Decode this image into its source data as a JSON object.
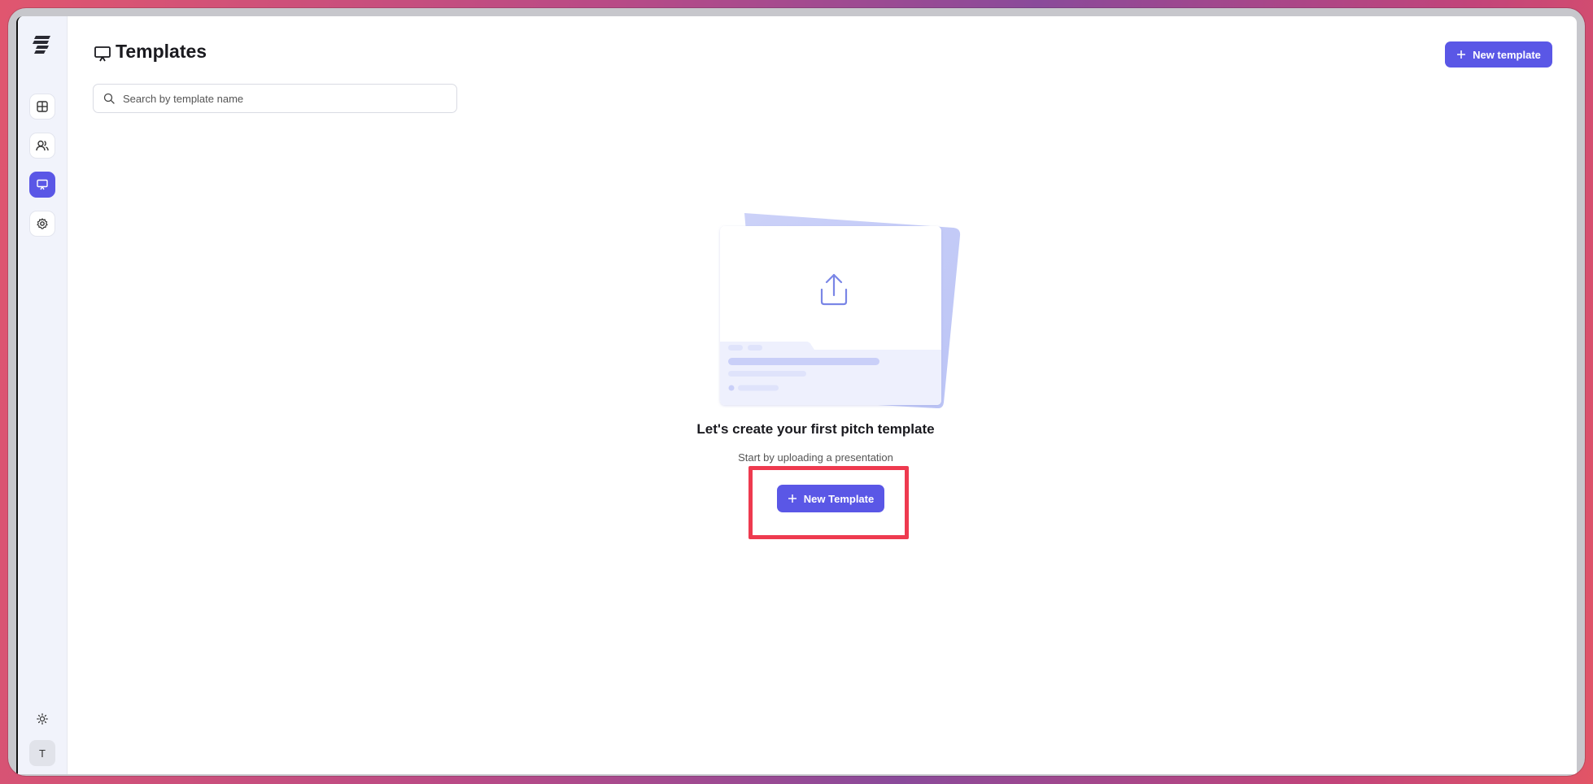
{
  "header": {
    "title": "Templates",
    "new_button_label": "New template"
  },
  "search": {
    "placeholder": "Search by template name",
    "value": ""
  },
  "sidebar": {
    "items": [
      {
        "name": "dashboard",
        "icon": "grid-icon"
      },
      {
        "name": "contacts",
        "icon": "users-icon"
      },
      {
        "name": "templates",
        "icon": "presentation-icon",
        "active": true
      },
      {
        "name": "settings",
        "icon": "gear-icon"
      }
    ],
    "avatar_initial": "T"
  },
  "empty_state": {
    "title": "Let's create your first pitch template",
    "subtitle": "Start by uploading a presentation",
    "button_label": "New Template"
  },
  "colors": {
    "accent": "#5a57e6",
    "highlight": "#ee3a4f"
  }
}
